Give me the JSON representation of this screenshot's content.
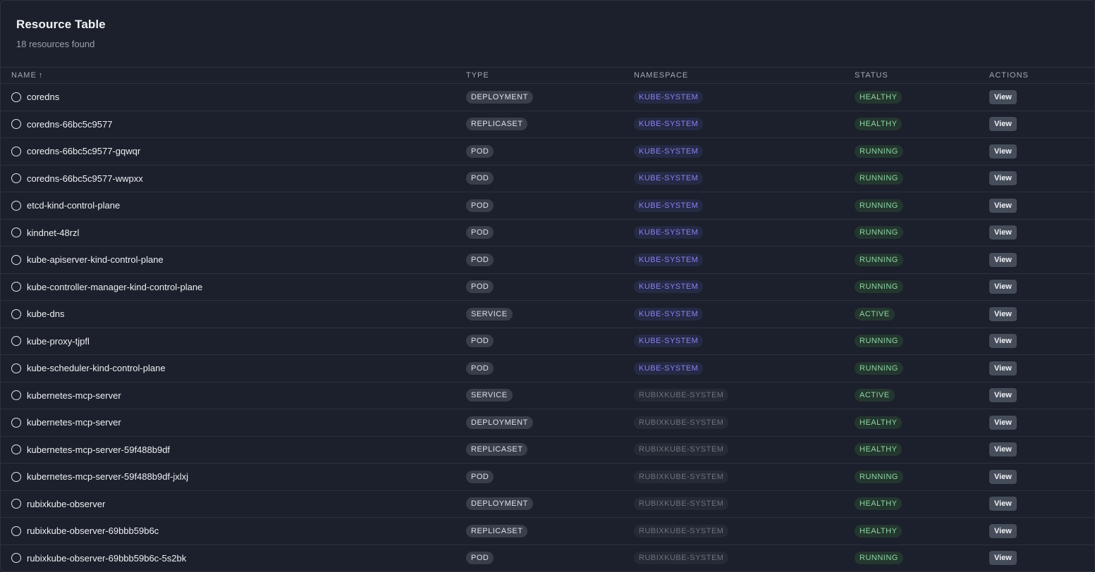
{
  "header": {
    "title": "Resource Table",
    "subtitle": "18 resources found"
  },
  "columns": {
    "name": "NAME",
    "name_sort": "↑",
    "type": "TYPE",
    "namespace": "NAMESPACE",
    "status": "STATUS",
    "actions": "ACTIONS"
  },
  "colors": {
    "background": "#1b202c",
    "namespace_kube": "#8b82f0",
    "status_green": "#8fd4a5"
  },
  "rows": [
    {
      "name": "coredns",
      "type": "DEPLOYMENT",
      "namespace": "KUBE-SYSTEM",
      "status": "HEALTHY",
      "action": "View"
    },
    {
      "name": "coredns-66bc5c9577",
      "type": "REPLICASET",
      "namespace": "KUBE-SYSTEM",
      "status": "HEALTHY",
      "action": "View"
    },
    {
      "name": "coredns-66bc5c9577-gqwqr",
      "type": "POD",
      "namespace": "KUBE-SYSTEM",
      "status": "RUNNING",
      "action": "View"
    },
    {
      "name": "coredns-66bc5c9577-wwpxx",
      "type": "POD",
      "namespace": "KUBE-SYSTEM",
      "status": "RUNNING",
      "action": "View"
    },
    {
      "name": "etcd-kind-control-plane",
      "type": "POD",
      "namespace": "KUBE-SYSTEM",
      "status": "RUNNING",
      "action": "View"
    },
    {
      "name": "kindnet-48rzl",
      "type": "POD",
      "namespace": "KUBE-SYSTEM",
      "status": "RUNNING",
      "action": "View"
    },
    {
      "name": "kube-apiserver-kind-control-plane",
      "type": "POD",
      "namespace": "KUBE-SYSTEM",
      "status": "RUNNING",
      "action": "View"
    },
    {
      "name": "kube-controller-manager-kind-control-plane",
      "type": "POD",
      "namespace": "KUBE-SYSTEM",
      "status": "RUNNING",
      "action": "View"
    },
    {
      "name": "kube-dns",
      "type": "SERVICE",
      "namespace": "KUBE-SYSTEM",
      "status": "ACTIVE",
      "action": "View"
    },
    {
      "name": "kube-proxy-tjpfl",
      "type": "POD",
      "namespace": "KUBE-SYSTEM",
      "status": "RUNNING",
      "action": "View"
    },
    {
      "name": "kube-scheduler-kind-control-plane",
      "type": "POD",
      "namespace": "KUBE-SYSTEM",
      "status": "RUNNING",
      "action": "View"
    },
    {
      "name": "kubernetes-mcp-server",
      "type": "SERVICE",
      "namespace": "RUBIXKUBE-SYSTEM",
      "status": "ACTIVE",
      "action": "View"
    },
    {
      "name": "kubernetes-mcp-server",
      "type": "DEPLOYMENT",
      "namespace": "RUBIXKUBE-SYSTEM",
      "status": "HEALTHY",
      "action": "View"
    },
    {
      "name": "kubernetes-mcp-server-59f488b9df",
      "type": "REPLICASET",
      "namespace": "RUBIXKUBE-SYSTEM",
      "status": "HEALTHY",
      "action": "View"
    },
    {
      "name": "kubernetes-mcp-server-59f488b9df-jxlxj",
      "type": "POD",
      "namespace": "RUBIXKUBE-SYSTEM",
      "status": "RUNNING",
      "action": "View"
    },
    {
      "name": "rubixkube-observer",
      "type": "DEPLOYMENT",
      "namespace": "RUBIXKUBE-SYSTEM",
      "status": "HEALTHY",
      "action": "View"
    },
    {
      "name": "rubixkube-observer-69bbb59b6c",
      "type": "REPLICASET",
      "namespace": "RUBIXKUBE-SYSTEM",
      "status": "HEALTHY",
      "action": "View"
    },
    {
      "name": "rubixkube-observer-69bbb59b6c-5s2bk",
      "type": "POD",
      "namespace": "RUBIXKUBE-SYSTEM",
      "status": "RUNNING",
      "action": "View"
    }
  ]
}
